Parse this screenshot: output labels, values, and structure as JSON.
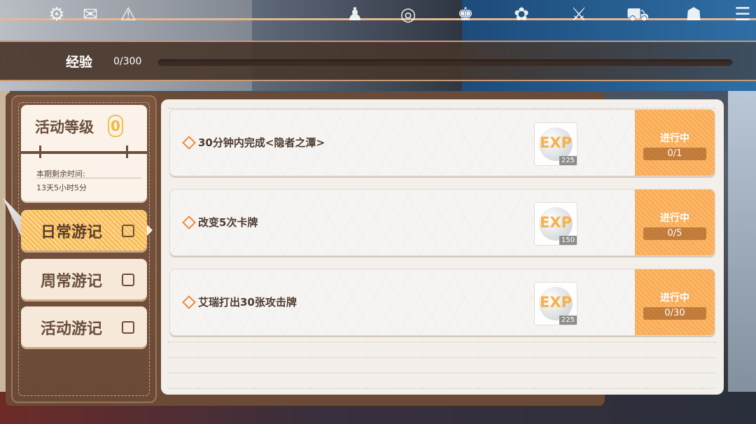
{
  "topbar": {
    "icons": [
      "settings-icon",
      "mail-icon",
      "notice-icon",
      "character-icon",
      "camera-icon",
      "wardrobe-icon",
      "gift-icon",
      "battle-icon",
      "shop-icon",
      "bag-icon",
      "more-icon"
    ]
  },
  "exp": {
    "label": "经验",
    "value": "0/300",
    "progress": 0.0
  },
  "level": {
    "title": "活动等级",
    "number": "0",
    "remaining_label": "本期剩余时间:",
    "remaining_value": "13天5小时5分"
  },
  "nav": [
    {
      "label": "日常游记",
      "active": true
    },
    {
      "label": "周常游记",
      "active": false
    },
    {
      "label": "活动游记",
      "active": false
    }
  ],
  "tasks": [
    {
      "name": "30分钟内完成<隐者之潭>",
      "reward_label": "EXP",
      "reward_count": "225",
      "status": "进行中",
      "progress": "0/1"
    },
    {
      "name": "改变5次卡牌",
      "reward_label": "EXP",
      "reward_count": "150",
      "status": "进行中",
      "progress": "0/5"
    },
    {
      "name": "艾瑞打出30张攻击牌",
      "reward_label": "EXP",
      "reward_count": "225",
      "status": "进行中",
      "progress": "0/30"
    }
  ],
  "colors": {
    "accent": "#f9a752",
    "panel": "#6b4a36",
    "text": "#4e3a2e"
  }
}
